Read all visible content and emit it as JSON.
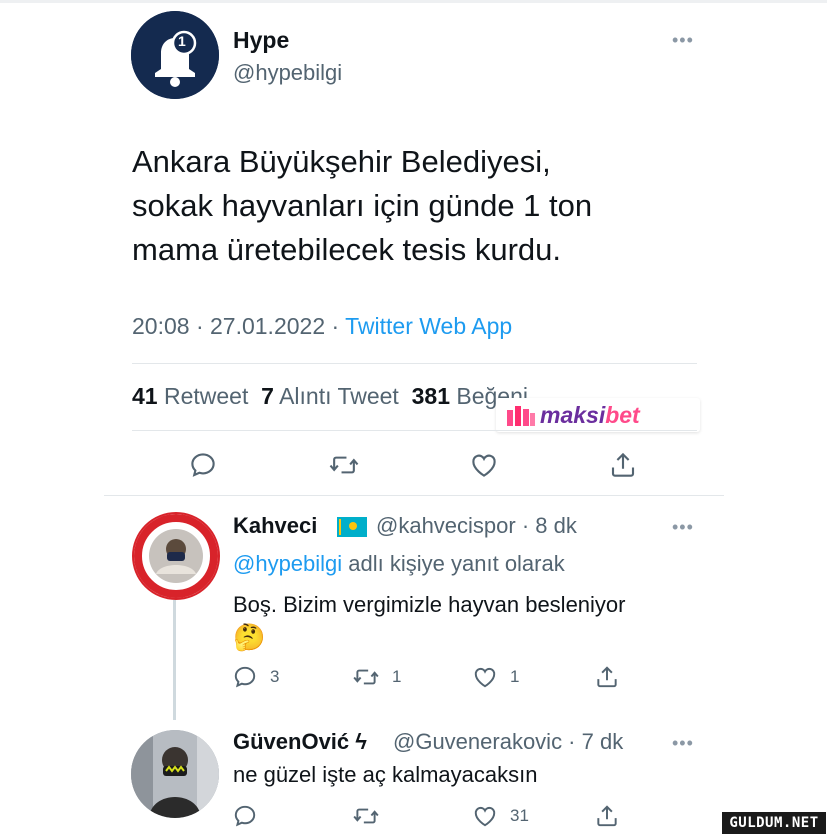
{
  "main_tweet": {
    "author_name": "Hype",
    "author_handle": "@hypebilgi",
    "avatar_badge": "1",
    "text_lines": [
      "Ankara Büyükşehir Belediyesi,",
      "sokak hayvanları için günde 1 ton",
      "mama üretebilecek tesis kurdu."
    ],
    "timestamp": "20:08 · 27.01.2022 · ",
    "source_app": "Twitter Web App",
    "stats": {
      "retweet_count": "41",
      "retweet_label": "Retweet",
      "quote_count": "7",
      "quote_label": "Alıntı Tweet",
      "like_count": "381",
      "like_label": "Beğeni"
    }
  },
  "watermark": {
    "brand_main": "maksi",
    "brand_accent": "bet"
  },
  "replies": [
    {
      "name": "Kahveci",
      "flag": "kazakhstan-flag-icon",
      "handle_time": "@kahvecispor · 8 dk",
      "reply_to_mention": "@hypebilgi",
      "reply_to_suffix": " adlı kişiye yanıt olarak",
      "text": "Boş. Bizim vergimizle hayvan besleniyor",
      "emoji": "🤔",
      "reply_count": "3",
      "retweet_count": "1",
      "like_count": "1"
    },
    {
      "name": "GüvenOvić",
      "lightning": "ϟ",
      "handle_time": "@Guvenerakovic · 7 dk",
      "text": "ne güzel işte aç kalmayacaksın",
      "like_count": "31"
    }
  ],
  "footer_watermark": "GULDUM.NET",
  "colors": {
    "link": "#1d9bf0",
    "secondary_text": "#536471",
    "avatar_bg": "#142a4f"
  }
}
